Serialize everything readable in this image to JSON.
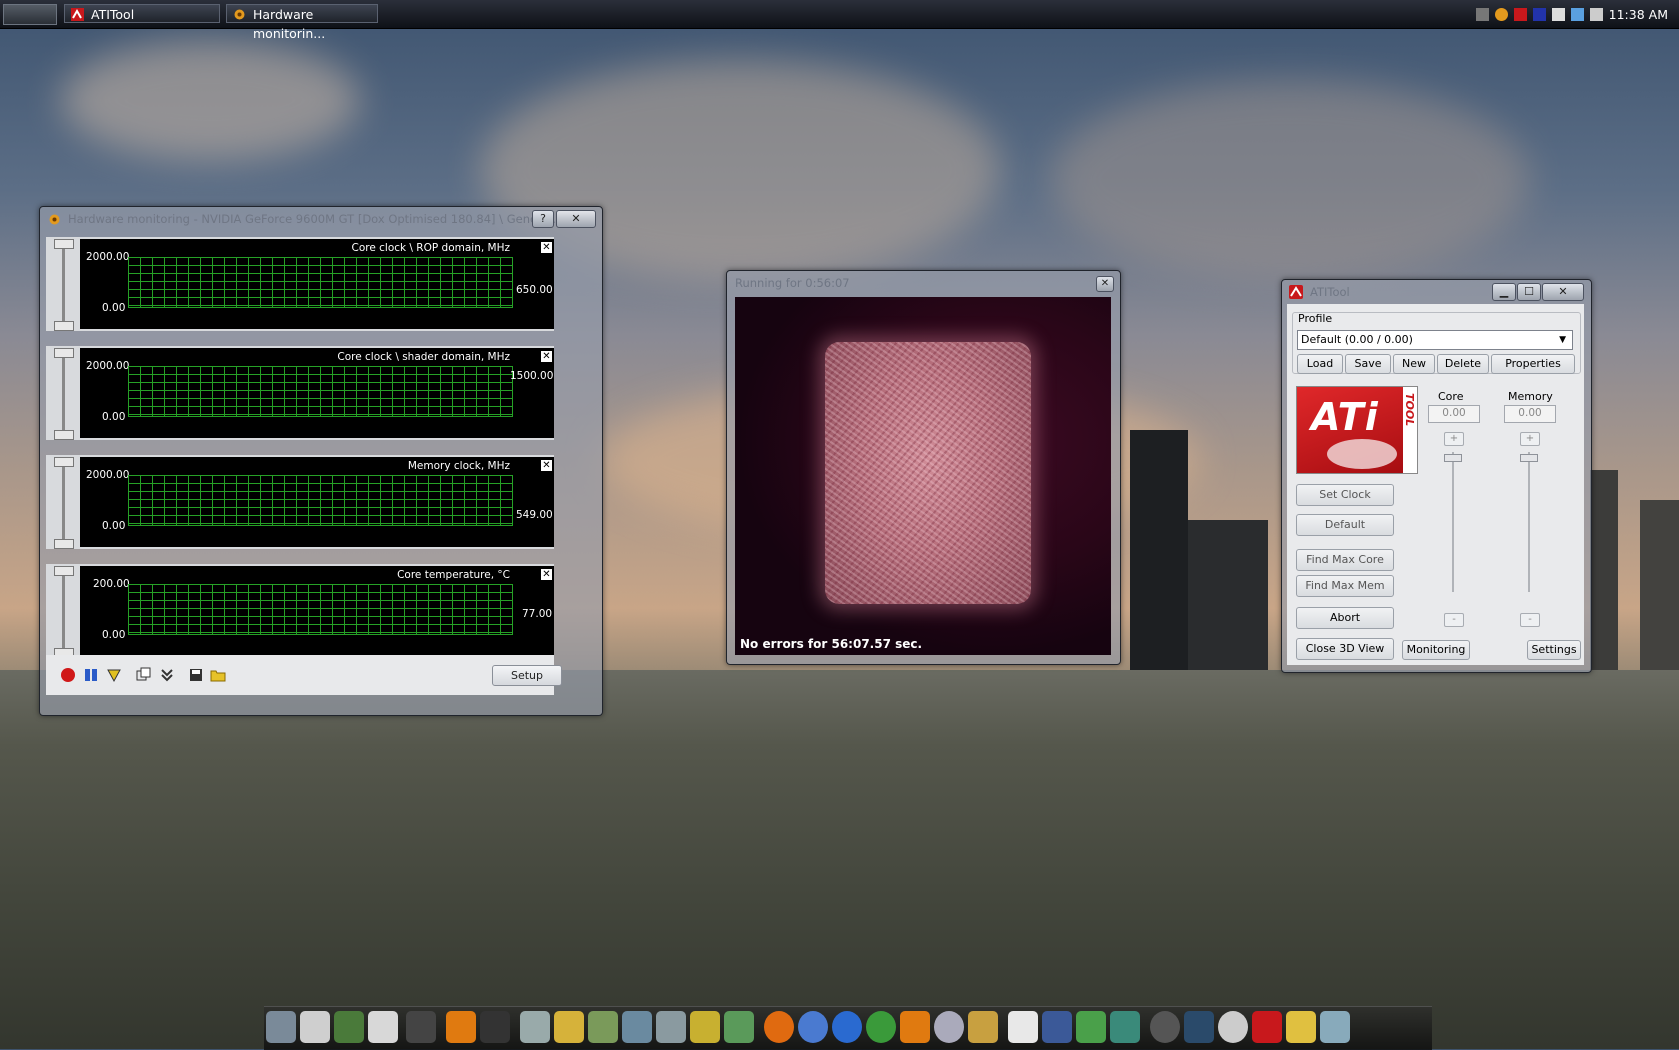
{
  "taskbar": {
    "tasks": [
      {
        "label": "ATITool",
        "icon": "atitool-icon"
      },
      {
        "label": "Hardware monitorin...",
        "icon": "gear-icon"
      }
    ],
    "clock": "11:38 AM"
  },
  "monitor_window": {
    "title": "Hardware monitoring - NVIDIA GeForce 9600M GT [Dox Optimised 180.84] \\ Generi...",
    "help_label": "?",
    "close_label": "✕",
    "graphs": [
      {
        "name": "Core clock \\ ROP domain, MHz",
        "ymax": "2000.00",
        "ymin": "0.00",
        "current": "650.00"
      },
      {
        "name": "Core clock \\ shader domain, MHz",
        "ymax": "2000.00",
        "ymin": "0.00",
        "current": "1500.00"
      },
      {
        "name": "Memory clock, MHz",
        "ymax": "2000.00",
        "ymin": "0.00",
        "current": "549.00"
      },
      {
        "name": "Core temperature, °C",
        "ymax": "200.00",
        "ymin": "0.00",
        "current": "77.00"
      }
    ],
    "graph_close": "✕",
    "setup_label": "Setup"
  },
  "view3d": {
    "title": "Running for 0:56:07",
    "close_label": "✕",
    "status": "No errors for 56:07.57 sec."
  },
  "atitool": {
    "title": "ATITool",
    "profile_group": "Profile",
    "profile_value": "Default (0.00 / 0.00)",
    "buttons": {
      "load": "Load",
      "save": "Save",
      "new": "New",
      "delete": "Delete",
      "properties": "Properties",
      "set_clock": "Set Clock",
      "default": "Default",
      "find_max_core": "Find Max Core",
      "find_max_mem": "Find Max Mem",
      "abort": "Abort",
      "close_3d": "Close 3D View",
      "monitoring": "Monitoring",
      "settings": "Settings"
    },
    "logo_text": "ATi",
    "logo_sub": "TOOL",
    "core_label": "Core",
    "memory_label": "Memory",
    "core_value": "0.00",
    "memory_value": "0.00",
    "plus": "+",
    "minus": "-"
  },
  "colors": {
    "graph_grid": "#2bb32b",
    "ati_red": "#c8181c"
  }
}
